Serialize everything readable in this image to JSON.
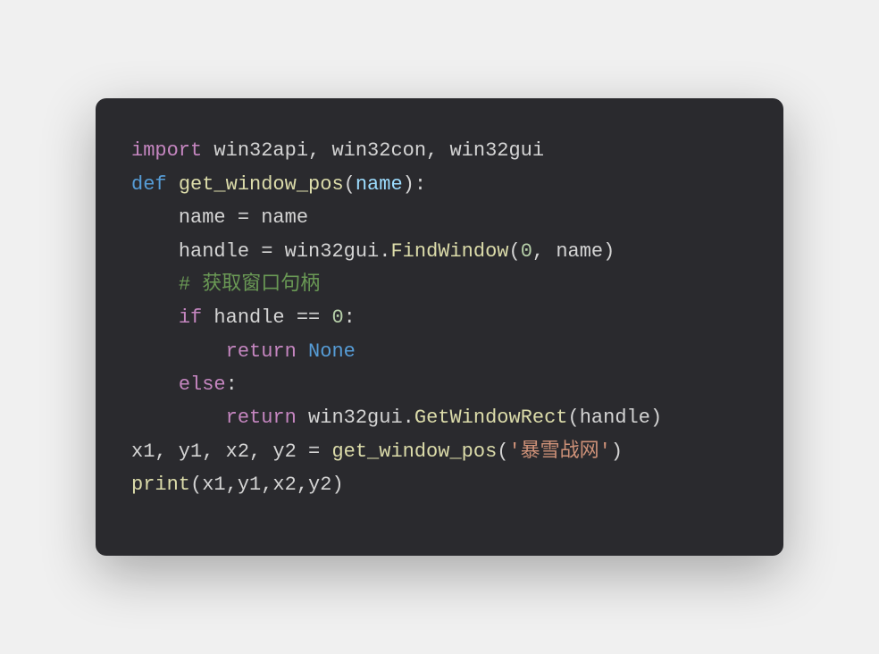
{
  "code": {
    "line1": {
      "import": "import",
      "modules": " win32api, win32con, win32gui"
    },
    "line2": {
      "def": "def",
      "space1": " ",
      "funcname": "get_window_pos",
      "lparen": "(",
      "param": "name",
      "rparen_colon": "):"
    },
    "line3": {
      "indent": "    ",
      "var": "name",
      "eq": " = ",
      "rhs": "name"
    },
    "line4": {
      "indent": "    ",
      "var": "handle",
      "eq": " = ",
      "mod": "win32gui.",
      "func": "FindWindow",
      "lparen": "(",
      "arg0": "0",
      "comma": ", ",
      "arg1": "name",
      "rparen": ")"
    },
    "line5": {
      "indent": "    ",
      "comment": "# 获取窗口句柄"
    },
    "line6": {
      "indent": "    ",
      "if": "if",
      "space": " ",
      "var": "handle",
      "op": " == ",
      "zero": "0",
      "colon": ":"
    },
    "line7": {
      "indent": "        ",
      "return": "return",
      "space": " ",
      "none": "None"
    },
    "line8": {
      "indent": "    ",
      "else": "else",
      "colon": ":"
    },
    "line9": {
      "indent": "        ",
      "return": "return",
      "space": " ",
      "mod": "win32gui.",
      "func": "GetWindowRect",
      "lparen": "(",
      "arg": "handle",
      "rparen": ")"
    },
    "line10": {
      "lhs": "x1, y1, x2, y2 = ",
      "func": "get_window_pos",
      "lparen": "(",
      "str": "'暴雪战网'",
      "rparen": ")"
    },
    "line11": {
      "func": "print",
      "lparen": "(",
      "args": "x1,y1,x2,y2",
      "rparen": ")"
    }
  }
}
